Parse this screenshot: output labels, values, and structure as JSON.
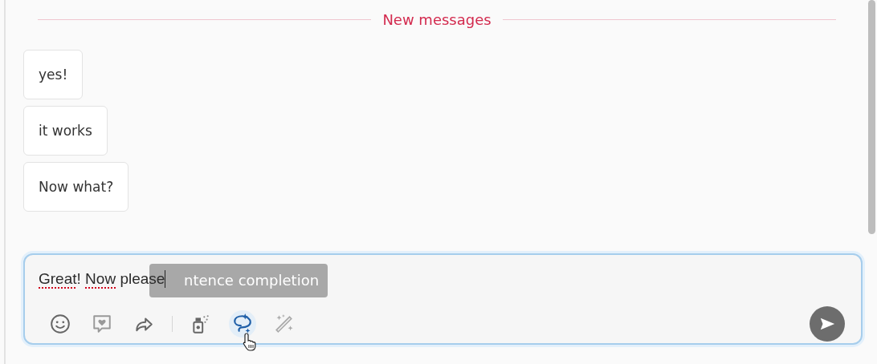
{
  "divider": {
    "label": "New messages"
  },
  "messages": [
    {
      "text": "yes!"
    },
    {
      "text": "it works"
    },
    {
      "text": "Now what?"
    }
  ],
  "composer": {
    "value": [
      {
        "text": "Great",
        "misspelled": true
      },
      {
        "text": "! ",
        "misspelled": false
      },
      {
        "text": "Now",
        "misspelled": true
      },
      {
        "text": " please",
        "misspelled": false
      }
    ],
    "tooltip": {
      "text": "ntence completion"
    },
    "tools": [
      {
        "kind": "emoji",
        "active": false
      },
      {
        "kind": "reaction",
        "active": false
      },
      {
        "kind": "forward",
        "active": false
      },
      {
        "kind": "separator"
      },
      {
        "kind": "spray",
        "active": false
      },
      {
        "kind": "completion",
        "active": true
      },
      {
        "kind": "wand",
        "active": false
      }
    ],
    "send": {
      "kind": "send"
    }
  }
}
